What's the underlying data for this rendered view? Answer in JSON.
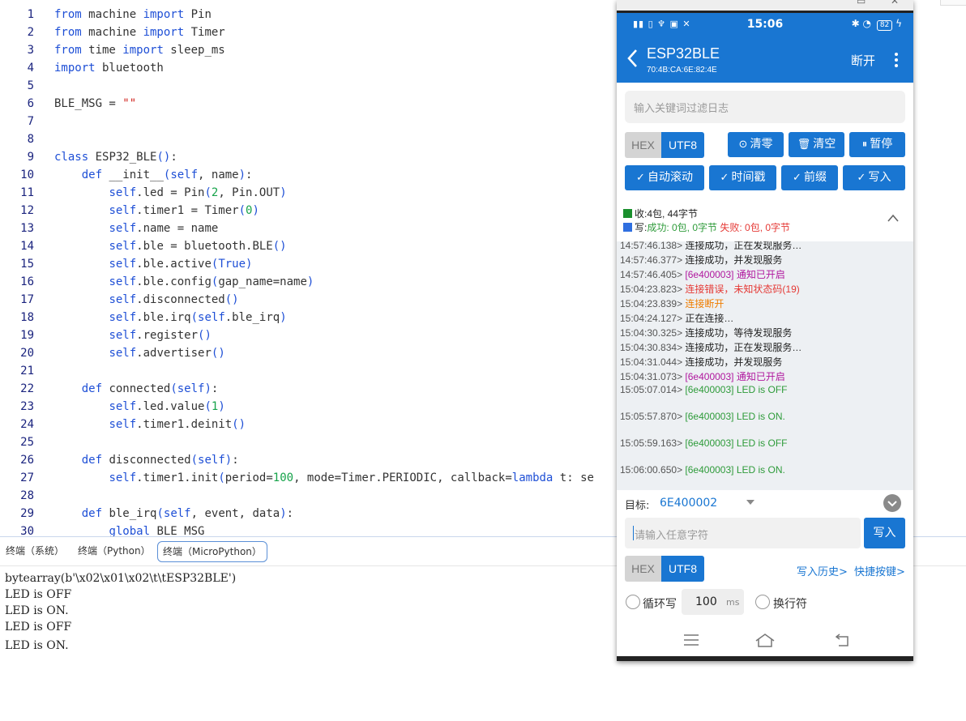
{
  "editor": {
    "lines": [
      {
        "n": "1",
        "code": "from machine import Pin"
      },
      {
        "n": "2",
        "code": "from machine import Timer"
      },
      {
        "n": "3",
        "code": "from time import sleep_ms"
      },
      {
        "n": "4",
        "code": "import bluetooth"
      },
      {
        "n": "5",
        "code": ""
      },
      {
        "n": "6",
        "code": "BLE_MSG = \"\""
      },
      {
        "n": "7",
        "code": ""
      },
      {
        "n": "8",
        "code": ""
      },
      {
        "n": "9",
        "code": "class ESP32_BLE():"
      },
      {
        "n": "10",
        "code": "    def __init__(self, name):"
      },
      {
        "n": "11",
        "code": "        self.led = Pin(2, Pin.OUT)"
      },
      {
        "n": "12",
        "code": "        self.timer1 = Timer(0)"
      },
      {
        "n": "13",
        "code": "        self.name = name"
      },
      {
        "n": "14",
        "code": "        self.ble = bluetooth.BLE()"
      },
      {
        "n": "15",
        "code": "        self.ble.active(True)"
      },
      {
        "n": "16",
        "code": "        self.ble.config(gap_name=name)"
      },
      {
        "n": "17",
        "code": "        self.disconnected()"
      },
      {
        "n": "18",
        "code": "        self.ble.irq(self.ble_irq)"
      },
      {
        "n": "19",
        "code": "        self.register()"
      },
      {
        "n": "20",
        "code": "        self.advertiser()"
      },
      {
        "n": "21",
        "code": ""
      },
      {
        "n": "22",
        "code": "    def connected(self):"
      },
      {
        "n": "23",
        "code": "        self.led.value(1)"
      },
      {
        "n": "24",
        "code": "        self.timer1.deinit()"
      },
      {
        "n": "25",
        "code": ""
      },
      {
        "n": "26",
        "code": "    def disconnected(self):"
      },
      {
        "n": "27",
        "code": "        self.timer1.init(period=100, mode=Timer.PERIODIC, callback=lambda t: se"
      },
      {
        "n": "28",
        "code": ""
      },
      {
        "n": "29",
        "code": "    def ble_irq(self, event, data):"
      },
      {
        "n": "30",
        "code": "        global BLE_MSG"
      }
    ]
  },
  "terminal": {
    "tabs": [
      "终端（系统）",
      "终端（Python）",
      "终端（MicroPython）"
    ],
    "active_tab": 2,
    "output": [
      "bytearray(b'\\x02\\x01\\x02\\t\\tESP32BLE')",
      "LED is OFF",
      "LED is ON.",
      "LED is OFF",
      "LED is ON."
    ]
  },
  "phone": {
    "status": {
      "time": "15:06",
      "battery": "82"
    },
    "app_bar": {
      "device_name": "ESP32BLE",
      "mac": "70:4B:CA:6E:82:4E",
      "disconnect_label": "断开"
    },
    "filter_placeholder": "输入关键词过滤日志",
    "toolbar1": {
      "hex": "HEX",
      "utf8": "UTF8",
      "reset": "清零",
      "clear": "清空",
      "pause": "暂停"
    },
    "toolbar2": {
      "auto_scroll": "自动滚动",
      "timestamp": "时间戳",
      "prefix": "前缀",
      "write": "写入"
    },
    "stats": {
      "received_text": "收:4包, 44字节",
      "write_prefix": "写:",
      "write_success": "成功: 0包, 0字节",
      "write_fail": "失败: 0包, 0字节"
    },
    "log": [
      {
        "time": "14:57:46.138>",
        "msg": "连接成功，正在发现服务…",
        "color": "#222222"
      },
      {
        "time": "14:57:46.377>",
        "msg": "连接成功，并发现服务",
        "color": "#222222"
      },
      {
        "time": "14:57:46.405>",
        "msg": "[6e400003] 通知已开启",
        "color": "#b0179e"
      },
      {
        "time": "15:04:23.823>",
        "msg": "连接错误，未知状态码(19)",
        "color": "#e53935"
      },
      {
        "time": "15:04:23.839>",
        "msg": "连接断开",
        "color": "#ef7d00"
      },
      {
        "time": "15:04:24.127>",
        "msg": "正在连接…",
        "color": "#222222"
      },
      {
        "time": "15:04:30.325>",
        "msg": "连接成功，等待发现服务",
        "color": "#222222"
      },
      {
        "time": "15:04:30.834>",
        "msg": "连接成功，正在发现服务…",
        "color": "#222222"
      },
      {
        "time": "15:04:31.044>",
        "msg": "连接成功，并发现服务",
        "color": "#222222"
      },
      {
        "time": "15:04:31.073>",
        "msg": "[6e400003] 通知已开启",
        "color": "#b0179e"
      },
      {
        "time": "15:05:07.014>",
        "msg": "[6e400003] LED is OFF",
        "color": "#2e9b3a"
      },
      {
        "time": "15:05:57.870>",
        "msg": "[6e400003] LED is ON.",
        "color": "#2e9b3a"
      },
      {
        "time": "15:05:59.163>",
        "msg": "[6e400003] LED is OFF",
        "color": "#2e9b3a"
      },
      {
        "time": "15:06:00.650>",
        "msg": "[6e400003] LED is ON.",
        "color": "#2e9b3a"
      }
    ],
    "target": {
      "label": "目标:",
      "value": "6E400002"
    },
    "send": {
      "placeholder": "请输入任意字符",
      "button": "写入"
    },
    "bottom": {
      "hex": "HEX",
      "utf8": "UTF8",
      "history": "写入历史>",
      "shortcuts": "快捷按键>"
    },
    "loop": {
      "label": "循环写",
      "interval": "100",
      "unit": "ms",
      "newline": "换行符"
    },
    "colors": {
      "primary": "#1976d2",
      "received": "#1a8f2d",
      "write": "#2f6fe0",
      "success": "#2e9b3a",
      "fail": "#e53935"
    }
  }
}
